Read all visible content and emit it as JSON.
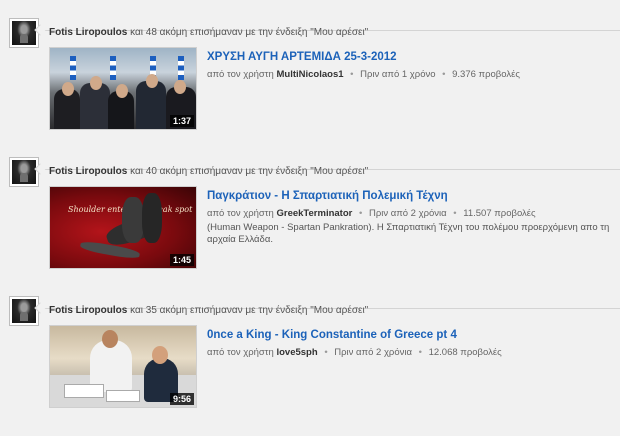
{
  "feed": [
    {
      "activity": {
        "user": "Fotis Liropoulos",
        "text": "και 48 ακόμη επισήμαναν με την ένδειξη \"Μου αρέσει\""
      },
      "video": {
        "title": "ΧΡΥΣΗ ΑΥΓΗ ΑΡΤΕΜΙΔΑ 25-3-2012",
        "by_prefix": "από τον χρήστη",
        "uploader": "MultiNicolaos1",
        "age": "Πριν από 1 χρόνο",
        "views": "9.376 προβολές",
        "duration": "1:37",
        "description": ""
      }
    },
    {
      "activity": {
        "user": "Fotis Liropoulos",
        "text": "και 40 ακόμη επισήμαναν με την ένδειξη \"Μου αρέσει\""
      },
      "video": {
        "title": "Παγκράτιον - Η Σπαρτιατική Πολεμική Τέχνη",
        "by_prefix": "από τον χρήστη",
        "uploader": "GreekTerminator",
        "age": "Πριν από 2 χρόνια",
        "views": "11.507 προβολές",
        "duration": "1:45",
        "description": "(Human Weapon - Spartan Pankration). Η Σπαρτιατική Τέχνη του πολέμου προερχόμενη απο τη αρχαία Ελλάδα.",
        "thumb_caption": "Shoulder enters the weak spot"
      }
    },
    {
      "activity": {
        "user": "Fotis Liropoulos",
        "text": "και 35 ακόμη επισήμαναν με την ένδειξη \"Μου αρέσει\""
      },
      "video": {
        "title": "0nce a King - King Constantine of Greece pt 4",
        "by_prefix": "από τον χρήστη",
        "uploader": "love5sph",
        "age": "Πριν από 2 χρόνια",
        "views": "12.068 προβολές",
        "duration": "9:56",
        "description": ""
      }
    }
  ],
  "separator": "•",
  "colors": {
    "link": "#1c62b9",
    "background": "#f1f1f1",
    "divider": "#d4d4d4"
  },
  "icons": {
    "avatar": "user-avatar-image"
  }
}
